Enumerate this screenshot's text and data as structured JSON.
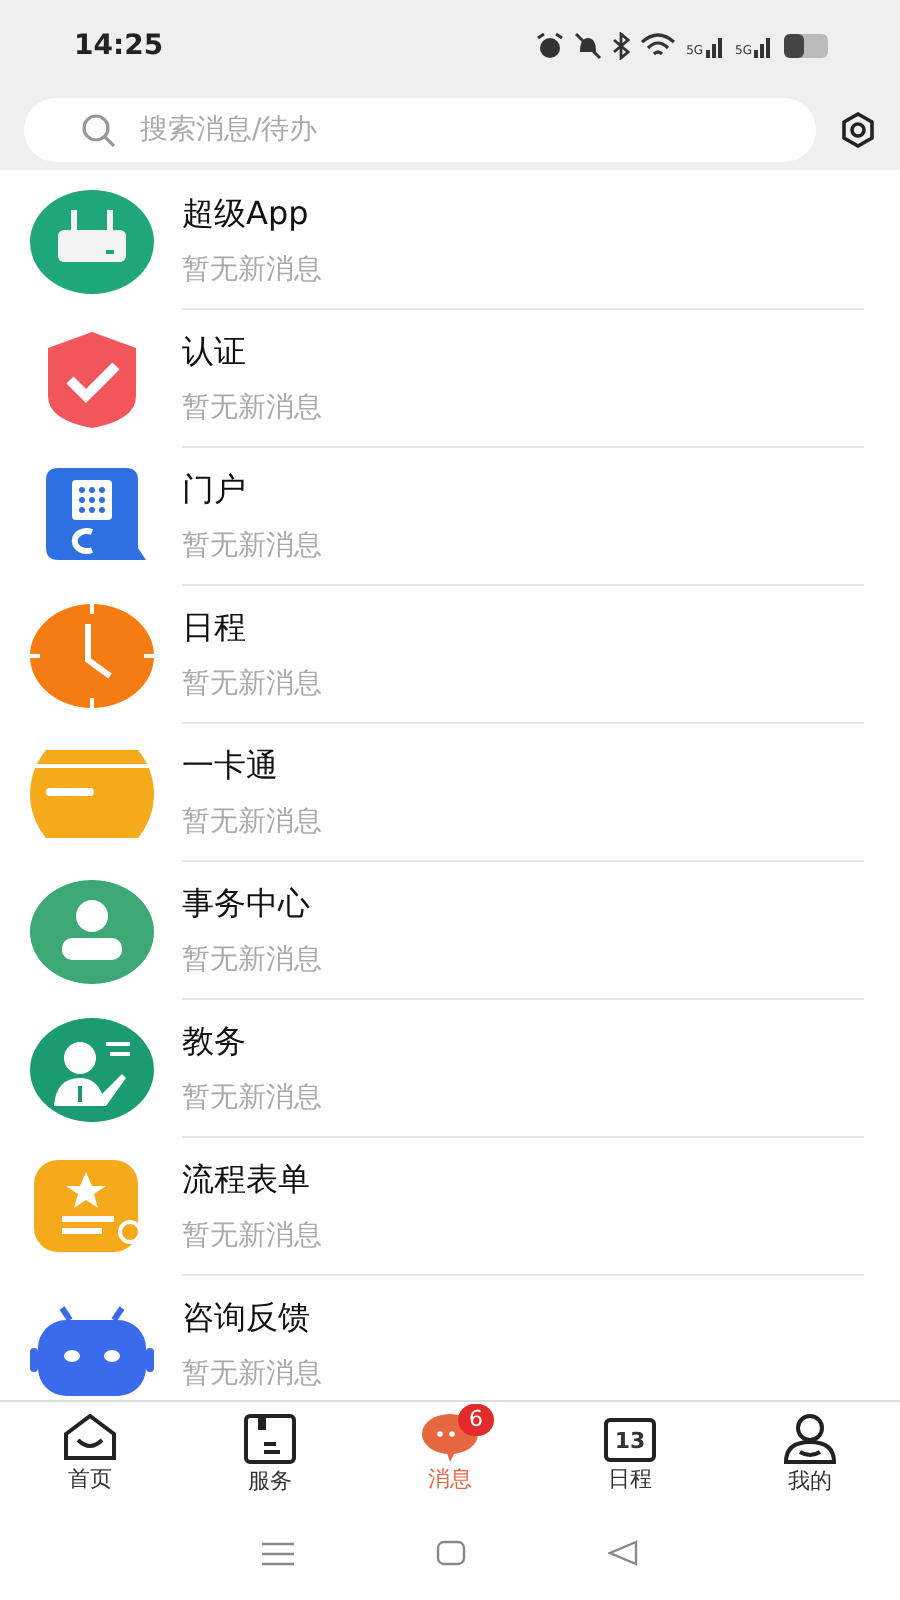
{
  "status_bar": {
    "time": "14:25",
    "signals": [
      "5G",
      "5G"
    ]
  },
  "search": {
    "placeholder": "搜索消息/待办"
  },
  "messages": [
    {
      "kind": "router",
      "title": "超级App",
      "subtitle": "暂无新消息"
    },
    {
      "kind": "shield",
      "title": "认证",
      "subtitle": "暂无新消息"
    },
    {
      "kind": "portal",
      "title": "门户",
      "subtitle": "暂无新消息"
    },
    {
      "kind": "clock",
      "title": "日程",
      "subtitle": "暂无新消息"
    },
    {
      "kind": "card",
      "title": "一卡通",
      "subtitle": "暂无新消息"
    },
    {
      "kind": "person",
      "title": "事务中心",
      "subtitle": "暂无新消息"
    },
    {
      "kind": "teacher",
      "title": "教务",
      "subtitle": "暂无新消息"
    },
    {
      "kind": "form",
      "title": "流程表单",
      "subtitle": "暂无新消息"
    },
    {
      "kind": "robot",
      "title": "咨询反馈",
      "subtitle": "暂无新消息"
    }
  ],
  "tabs": [
    {
      "kind": "home",
      "label": "首页",
      "selected": false
    },
    {
      "kind": "service",
      "label": "服务",
      "selected": false
    },
    {
      "kind": "chat",
      "label": "消息",
      "selected": true,
      "badge": "6"
    },
    {
      "kind": "calendar",
      "label": "日程",
      "selected": false,
      "icon_text": "13"
    },
    {
      "kind": "user",
      "label": "我的",
      "selected": false
    }
  ]
}
